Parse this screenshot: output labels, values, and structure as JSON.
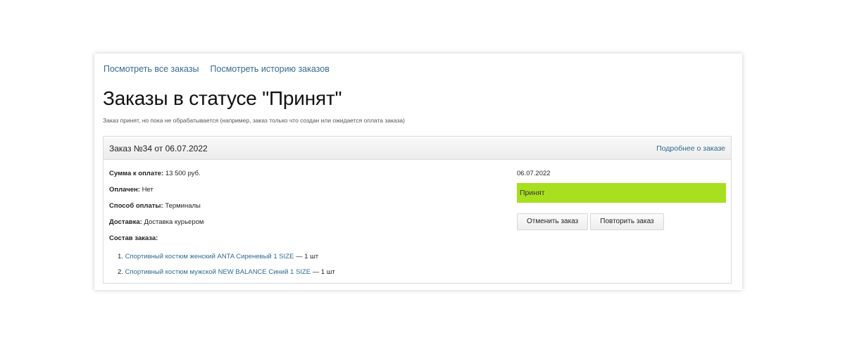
{
  "nav": {
    "all_orders": "Посмотреть все заказы",
    "history": "Посмотреть историю заказов"
  },
  "page": {
    "title": "Заказы в статусе \"Принят\"",
    "subtitle": "Заказ принят, но пока не обрабатывается (например, заказ только что создан или ожидается оплата заказа)"
  },
  "order": {
    "title": "Заказ №34 от 06.07.2022",
    "more_link": "Подробнее о заказе",
    "fields": [
      {
        "label": "Сумма к оплате:",
        "value": "13 500 руб."
      },
      {
        "label": "Оплачен:",
        "value": "Нет"
      },
      {
        "label": "Способ оплаты:",
        "value": "Терминалы"
      },
      {
        "label": "Доставка:",
        "value": "Доставка курьером"
      },
      {
        "label": "Состав заказа:",
        "value": ""
      }
    ],
    "items": [
      {
        "num": "1.",
        "name": "Спортивный костюм женский ANTA Сиреневый 1 SIZE",
        "qty": "— 1 шт"
      },
      {
        "num": "2.",
        "name": "Спортивный костюм мужской NEW BALANCE Синий 1 SIZE",
        "qty": "— 1 шт"
      }
    ],
    "date": "06.07.2022",
    "status": "Принят",
    "status_color": "#a8e01f",
    "cancel_label": "Отменить заказ",
    "repeat_label": "Повторить заказ"
  }
}
